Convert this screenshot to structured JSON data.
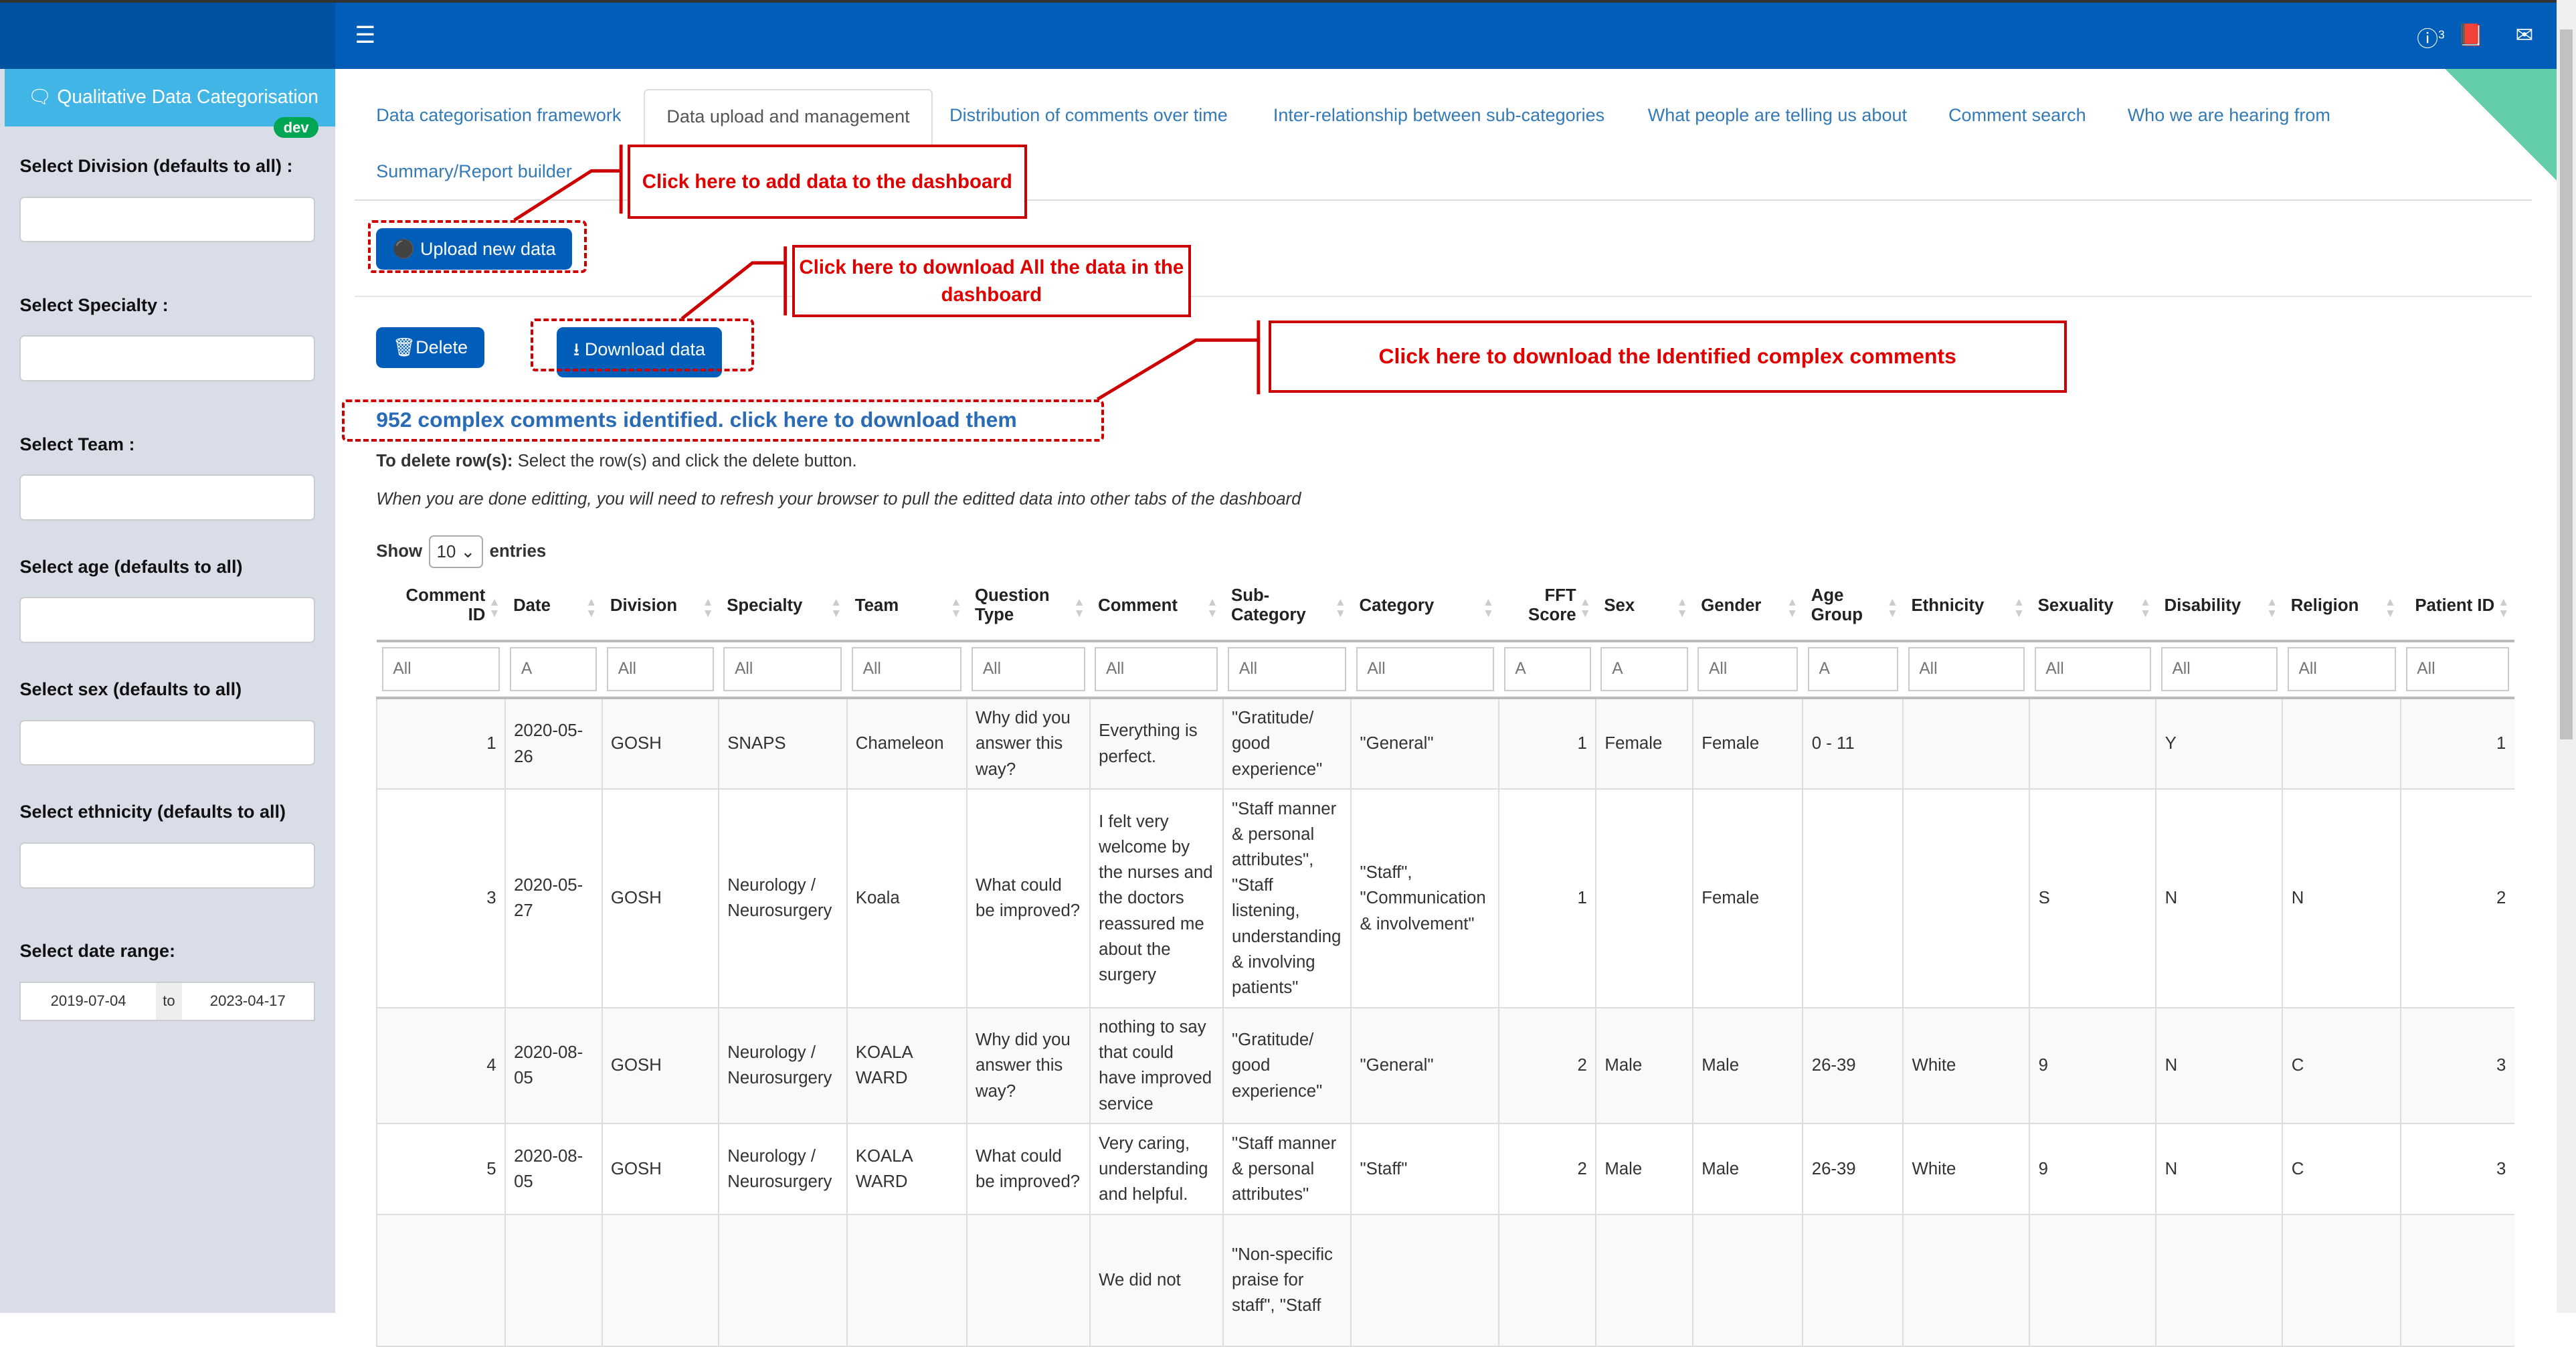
{
  "header": {
    "badge_count": "3"
  },
  "sidebar": {
    "brand": "Qualitative Data Categorisation",
    "dev_badge": "dev",
    "filters": [
      "Select Division (defaults to all) :",
      "Select Specialty :",
      "Select Team :",
      "Select age (defaults to all)",
      "Select sex (defaults to all)",
      "Select ethnicity (defaults to all)"
    ],
    "date_label": "Select date range:",
    "date_from": "2019-07-04",
    "date_to_sep": "to",
    "date_to": "2023-04-17"
  },
  "tabs": [
    "Data categorisation framework",
    "Data upload and management",
    "Distribution of comments over time",
    "Inter-relationship between sub-categories",
    "What people are telling us about",
    "Comment search",
    "Who we are hearing from",
    "Summary/Report builder"
  ],
  "buttons": {
    "upload": "Upload new data",
    "delete": "Delete",
    "download": "Download data"
  },
  "annotations": {
    "add": "Click here to add data to the dashboard",
    "download_all": "Click here to download All the data in the dashboard",
    "download_complex": "Click here to download the Identified complex comments"
  },
  "complex_link": "952 complex comments identified. click here to download them",
  "instructions": {
    "delete_bold": "To delete row(s):",
    "delete_text": " Select the row(s) and click the delete button.",
    "refresh": "When you are done editting, you will need to refresh your browser to pull the editted data into other tabs of the dashboard"
  },
  "length": {
    "show": "Show",
    "value": "10",
    "entries": "entries"
  },
  "table": {
    "columns": [
      "Comment ID",
      "Date",
      "Division",
      "Specialty",
      "Team",
      "Question Type",
      "Comment",
      "Sub-Category",
      "Category",
      "FFT Score",
      "Sex",
      "Gender",
      "Age Group",
      "Ethnicity",
      "Sexuality",
      "Disability",
      "Religion",
      "Patient ID"
    ],
    "filter_placeholders": [
      "All",
      "A",
      "All",
      "All",
      "All",
      "All",
      "All",
      "All",
      "All",
      "A",
      "A",
      "All",
      "A",
      "All",
      "All",
      "All",
      "All",
      "All"
    ],
    "rows": [
      [
        "1",
        "2020-05-26",
        "GOSH",
        "SNAPS",
        "Chameleon",
        "Why did you answer this way?",
        "Everything is perfect.",
        "\"Gratitude/ good experience\"",
        "\"General\"",
        "1",
        "Female",
        "Female",
        "0 - 11",
        "",
        "",
        "Y",
        "",
        "1"
      ],
      [
        "3",
        "2020-05-27",
        "GOSH",
        "Neurology / Neurosurgery",
        "Koala",
        "What could be improved?",
        "I felt very welcome by the nurses and the doctors reassured me about the surgery",
        "\"Staff manner & personal attributes\", \"Staff listening, understanding & involving patients\"",
        "\"Staff\", \"Communication & involvement\"",
        "1",
        "",
        "Female",
        "",
        "",
        "S",
        "N",
        "N",
        "2"
      ],
      [
        "4",
        "2020-08-05",
        "GOSH",
        "Neurology / Neurosurgery",
        "KOALA WARD",
        "Why did you answer this way?",
        "nothing to say that could have improved service",
        "\"Gratitude/ good experience\"",
        "\"General\"",
        "2",
        "Male",
        "Male",
        "26-39",
        "White",
        "9",
        "N",
        "C",
        "3"
      ],
      [
        "5",
        "2020-08-05",
        "GOSH",
        "Neurology / Neurosurgery",
        "KOALA WARD",
        "What could be improved?",
        "Very caring, understanding and helpful.",
        "\"Staff manner & personal attributes\"",
        "\"Staff\"",
        "2",
        "Male",
        "Male",
        "26-39",
        "White",
        "9",
        "N",
        "C",
        "3"
      ],
      [
        "",
        "",
        "",
        "",
        "",
        "",
        "We did not",
        "\"Non-specific praise for staff\", \"Staff",
        "",
        "",
        "",
        "",
        "",
        "",
        "",
        "",
        "",
        ""
      ]
    ]
  }
}
